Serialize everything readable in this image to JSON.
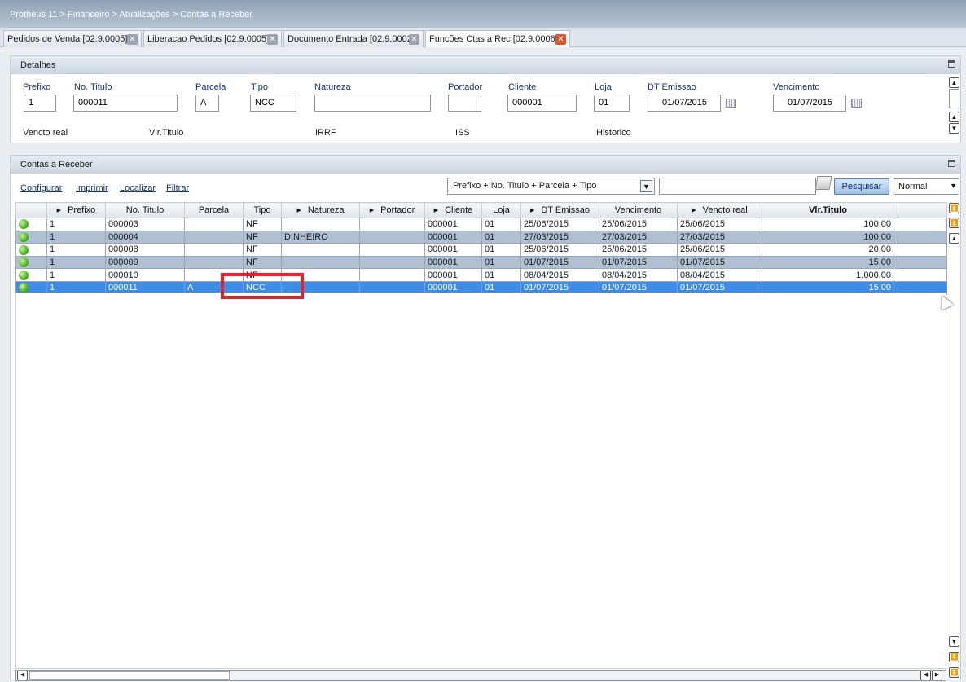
{
  "breadcrumb": "Protheus 11 > Financeiro > Atualizações > Contas a Receber",
  "tabs": [
    {
      "label": "Pedidos de Venda [02.9.0005]"
    },
    {
      "label": "Liberacao Pedidos [02.9.0005]"
    },
    {
      "label": "Documento Entrada [02.9.0002]"
    },
    {
      "label": "Funcões Ctas a Rec [02.9.0006]",
      "active": true
    }
  ],
  "details": {
    "title": "Detalhes",
    "fields": {
      "prefixo": {
        "label": "Prefixo",
        "value": "1"
      },
      "no_titulo": {
        "label": "No. Titulo",
        "value": "000011"
      },
      "parcela": {
        "label": "Parcela",
        "value": "A"
      },
      "tipo": {
        "label": "Tipo",
        "value": "NCC"
      },
      "natureza": {
        "label": "Natureza",
        "value": ""
      },
      "portador": {
        "label": "Portador",
        "value": ""
      },
      "cliente": {
        "label": "Cliente",
        "value": "000001"
      },
      "loja": {
        "label": "Loja",
        "value": "01"
      },
      "dt_emissao": {
        "label": "DT Emissao",
        "value": "01/07/2015"
      },
      "vencimento": {
        "label": "Vencimento",
        "value": "01/07/2015"
      }
    },
    "labels_row2": [
      "Vencto real",
      "Vlr.Titulo",
      "IRRF",
      "ISS",
      "Historico"
    ]
  },
  "contas": {
    "title": "Contas a Receber",
    "links": [
      "Configurar",
      "Imprimir",
      "Localizar",
      "Filtrar"
    ],
    "sort_value": "Prefixo + No. Titulo + Parcela + Tipo",
    "search_value": "",
    "search_button": "Pesquisar",
    "mode_value": "Normal",
    "columns": [
      "",
      "Prefixo",
      "No. Titulo",
      "Parcela",
      "Tipo",
      "Natureza",
      "Portador",
      "Cliente",
      "Loja",
      "DT Emissao",
      "Vencimento",
      "Vencto real",
      "Vlr.Titulo",
      ""
    ],
    "rows": [
      [
        "1",
        "000003",
        "",
        "NF",
        "",
        "",
        "000001",
        "01",
        "25/06/2015",
        "25/06/2015",
        "25/06/2015",
        "100,00"
      ],
      [
        "1",
        "000004",
        "",
        "NF",
        "DINHEIRO",
        "",
        "000001",
        "01",
        "27/03/2015",
        "27/03/2015",
        "27/03/2015",
        "100,00"
      ],
      [
        "1",
        "000008",
        "",
        "NF",
        "",
        "",
        "000001",
        "01",
        "25/06/2015",
        "25/06/2015",
        "25/06/2015",
        "20,00"
      ],
      [
        "1",
        "000009",
        "",
        "NF",
        "",
        "",
        "000001",
        "01",
        "01/07/2015",
        "01/07/2015",
        "01/07/2015",
        "15,00"
      ],
      [
        "1",
        "000010",
        "",
        "NF",
        "",
        "",
        "000001",
        "01",
        "08/04/2015",
        "08/04/2015",
        "08/04/2015",
        "1.000,00"
      ],
      [
        "1",
        "000011",
        "A",
        "NCC",
        "",
        "",
        "000001",
        "01",
        "01/07/2015",
        "01/07/2015",
        "01/07/2015",
        "15,00"
      ]
    ],
    "selected_row": 5
  }
}
